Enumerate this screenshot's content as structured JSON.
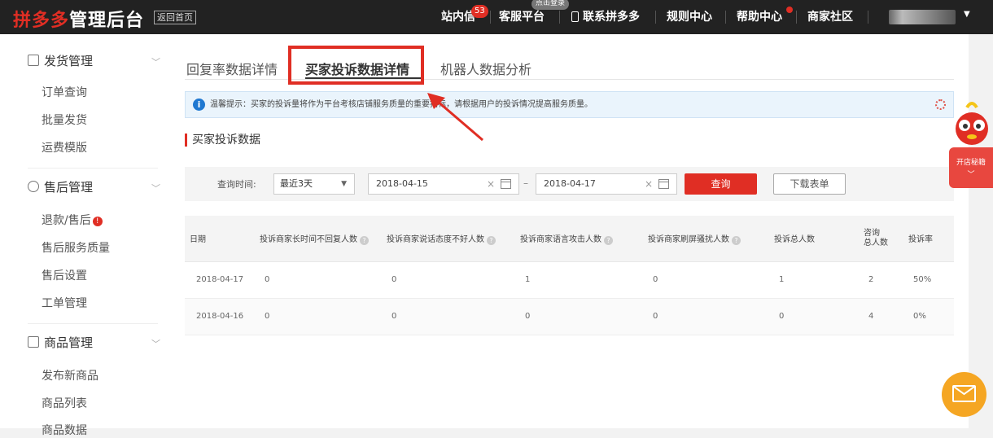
{
  "topbar": {
    "logo_brand": "拼多多",
    "logo_rest": "管理后台",
    "back_home": "返回首页",
    "nav": {
      "messages": "站内信",
      "messages_badge": "53",
      "service": "客服平台",
      "service_bubble": "点击登录",
      "contact": "联系拼多多",
      "rules": "规则中心",
      "help": "帮助中心",
      "community": "商家社区"
    }
  },
  "sidebar": {
    "groups": [
      {
        "label": "发货管理",
        "items": [
          "订单查询",
          "批量发货",
          "运费模版"
        ]
      },
      {
        "label": "售后管理",
        "items": [
          "退款/售后",
          "售后服务质量",
          "售后设置",
          "工单管理"
        ]
      },
      {
        "label": "商品管理",
        "items": [
          "发布新商品",
          "商品列表",
          "商品数据"
        ]
      }
    ],
    "refund_badge": "!"
  },
  "tabs": [
    "回复率数据详情",
    "买家投诉数据详情",
    "机器人数据分析"
  ],
  "notice": {
    "text": "温馨提示：买家的投诉量将作为平台考核店铺服务质量的重要指标，请根据用户的投诉情况提高服务质量。",
    "info_icon": "i"
  },
  "section_title": "买家投诉数据",
  "filter": {
    "label": "查询时间:",
    "range": "最近3天",
    "start": "2018-04-15",
    "end": "2018-04-17",
    "dash": "–",
    "query_button": "查询",
    "download_button": "下载表单"
  },
  "table": {
    "headers": [
      "日期",
      "投诉商家长时间不回复人数",
      "投诉商家说话态度不好人数",
      "投诉商家语言攻击人数",
      "投诉商家刷屏骚扰人数",
      "投诉总人数",
      "咨询总人数",
      "投诉率"
    ],
    "consult_line1": "咨询",
    "consult_line2": "总人数",
    "rows": [
      [
        "2018-04-17",
        "0",
        "0",
        "1",
        "0",
        "1",
        "2",
        "50%"
      ],
      [
        "2018-04-16",
        "0",
        "0",
        "0",
        "0",
        "0",
        "4",
        "0%"
      ]
    ]
  },
  "floating": {
    "open_shop_tips": "开店秘籍"
  },
  "colors": {
    "brand_red": "#e02e24",
    "topbar_bg": "#222222",
    "info_blue": "#1f78d1",
    "mail_orange": "#f5a623"
  }
}
